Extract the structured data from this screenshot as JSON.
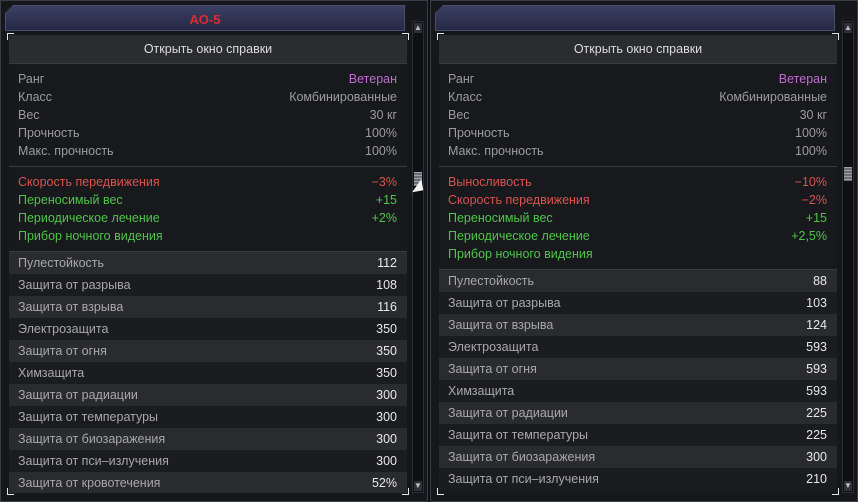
{
  "left": {
    "title": "АО-5",
    "help_button": "Открыть окно справки",
    "info": [
      {
        "label": "Ранг",
        "value": "Ветеран",
        "kind": "rank"
      },
      {
        "label": "Класс",
        "value": "Комбинированные"
      },
      {
        "label": "Вес",
        "value": "30 кг"
      },
      {
        "label": "Прочность",
        "value": "100%"
      },
      {
        "label": "Макс. прочность",
        "value": "100%"
      }
    ],
    "mods": [
      {
        "label": "Скорость передвижения",
        "value": "−3%",
        "color": "red"
      },
      {
        "label": "Переносимый вес",
        "value": "+15",
        "color": "green"
      },
      {
        "label": "Периодическое лечение",
        "value": "+2%",
        "color": "green"
      },
      {
        "label": "Прибор ночного видения",
        "value": "",
        "color": "green"
      }
    ],
    "stats": [
      {
        "label": "Пулестойкость",
        "value": "112"
      },
      {
        "label": "Защита от разрыва",
        "value": "108"
      },
      {
        "label": "Защита от взрыва",
        "value": "116"
      },
      {
        "label": "Электрозащита",
        "value": "350"
      },
      {
        "label": "Защита от огня",
        "value": "350"
      },
      {
        "label": "Химзащита",
        "value": "350"
      },
      {
        "label": "Защита от радиации",
        "value": "300"
      },
      {
        "label": "Защита от температуры",
        "value": "300"
      },
      {
        "label": "Защита от биозаражения",
        "value": "300"
      },
      {
        "label": "Защита от пси–излучения",
        "value": "300"
      },
      {
        "label": "Защита от кровотечения",
        "value": "52%"
      }
    ]
  },
  "right": {
    "title": "",
    "help_button": "Открыть окно справки",
    "info": [
      {
        "label": "Ранг",
        "value": "Ветеран",
        "kind": "rank"
      },
      {
        "label": "Класс",
        "value": "Комбинированные"
      },
      {
        "label": "Вес",
        "value": "30 кг"
      },
      {
        "label": "Прочность",
        "value": "100%"
      },
      {
        "label": "Макс. прочность",
        "value": "100%"
      }
    ],
    "mods": [
      {
        "label": "Выносливость",
        "value": "−10%",
        "color": "red"
      },
      {
        "label": "Скорость передвижения",
        "value": "−2%",
        "color": "red"
      },
      {
        "label": "Переносимый вес",
        "value": "+15",
        "color": "green"
      },
      {
        "label": "Периодическое лечение",
        "value": "+2,5%",
        "color": "green"
      },
      {
        "label": "Прибор ночного видения",
        "value": "",
        "color": "green"
      }
    ],
    "stats": [
      {
        "label": "Пулестойкость",
        "value": "88"
      },
      {
        "label": "Защита от разрыва",
        "value": "103"
      },
      {
        "label": "Защита от взрыва",
        "value": "124"
      },
      {
        "label": "Электрозащита",
        "value": "593"
      },
      {
        "label": "Защита от огня",
        "value": "593"
      },
      {
        "label": "Химзащита",
        "value": "593"
      },
      {
        "label": "Защита от радиации",
        "value": "225"
      },
      {
        "label": "Защита от температуры",
        "value": "225"
      },
      {
        "label": "Защита от биозаражения",
        "value": "300"
      },
      {
        "label": "Защита от пси–излучения",
        "value": "210"
      }
    ]
  },
  "colors": {
    "rank": "#c06bd0",
    "negative": "#d9534f",
    "positive": "#4fc44b",
    "title": "#e02a35"
  },
  "icons": {
    "scroll_up": "triangle-up-icon",
    "scroll_down": "triangle-down-icon",
    "cursor": "mouse-pointer-icon"
  }
}
